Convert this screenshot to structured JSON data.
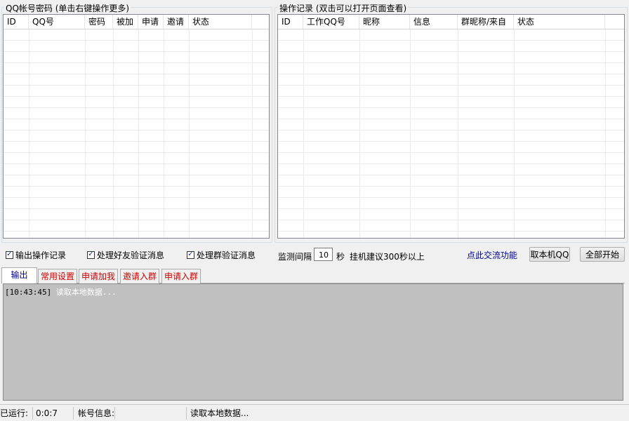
{
  "left_panel": {
    "title": "QQ帐号密码 (单击右键操作更多)",
    "columns": [
      "ID",
      "QQ号",
      "密码",
      "被加",
      "申请",
      "邀请",
      "状态"
    ]
  },
  "right_panel": {
    "title": "操作记录 (双击可以打开页面查看)",
    "columns": [
      "ID",
      "工作QQ号",
      "昵称",
      "信息",
      "群昵称/来自",
      "状态"
    ]
  },
  "options": {
    "output_log": "输出操作记录",
    "friend_verify": "处理好友验证消息",
    "group_verify": "处理群验证消息",
    "interval_label": "监测间隔",
    "interval_value": "10",
    "interval_unit": "秒",
    "interval_hint": "挂机建议300秒以上",
    "link_text": "点此交流功能",
    "btn_fetch": "取本机QQ",
    "btn_start": "全部开始"
  },
  "tabs": [
    "输出",
    "常用设置",
    "申请加我",
    "邀请入群",
    "申请入群"
  ],
  "output": {
    "timestamp": "[10:43:45]",
    "message": "读取本地数据..."
  },
  "status": {
    "running_label": "已运行:",
    "running_value": "0:0:7",
    "account_label": "帐号信息:",
    "account_value": "",
    "status_message": "读取本地数据..."
  }
}
